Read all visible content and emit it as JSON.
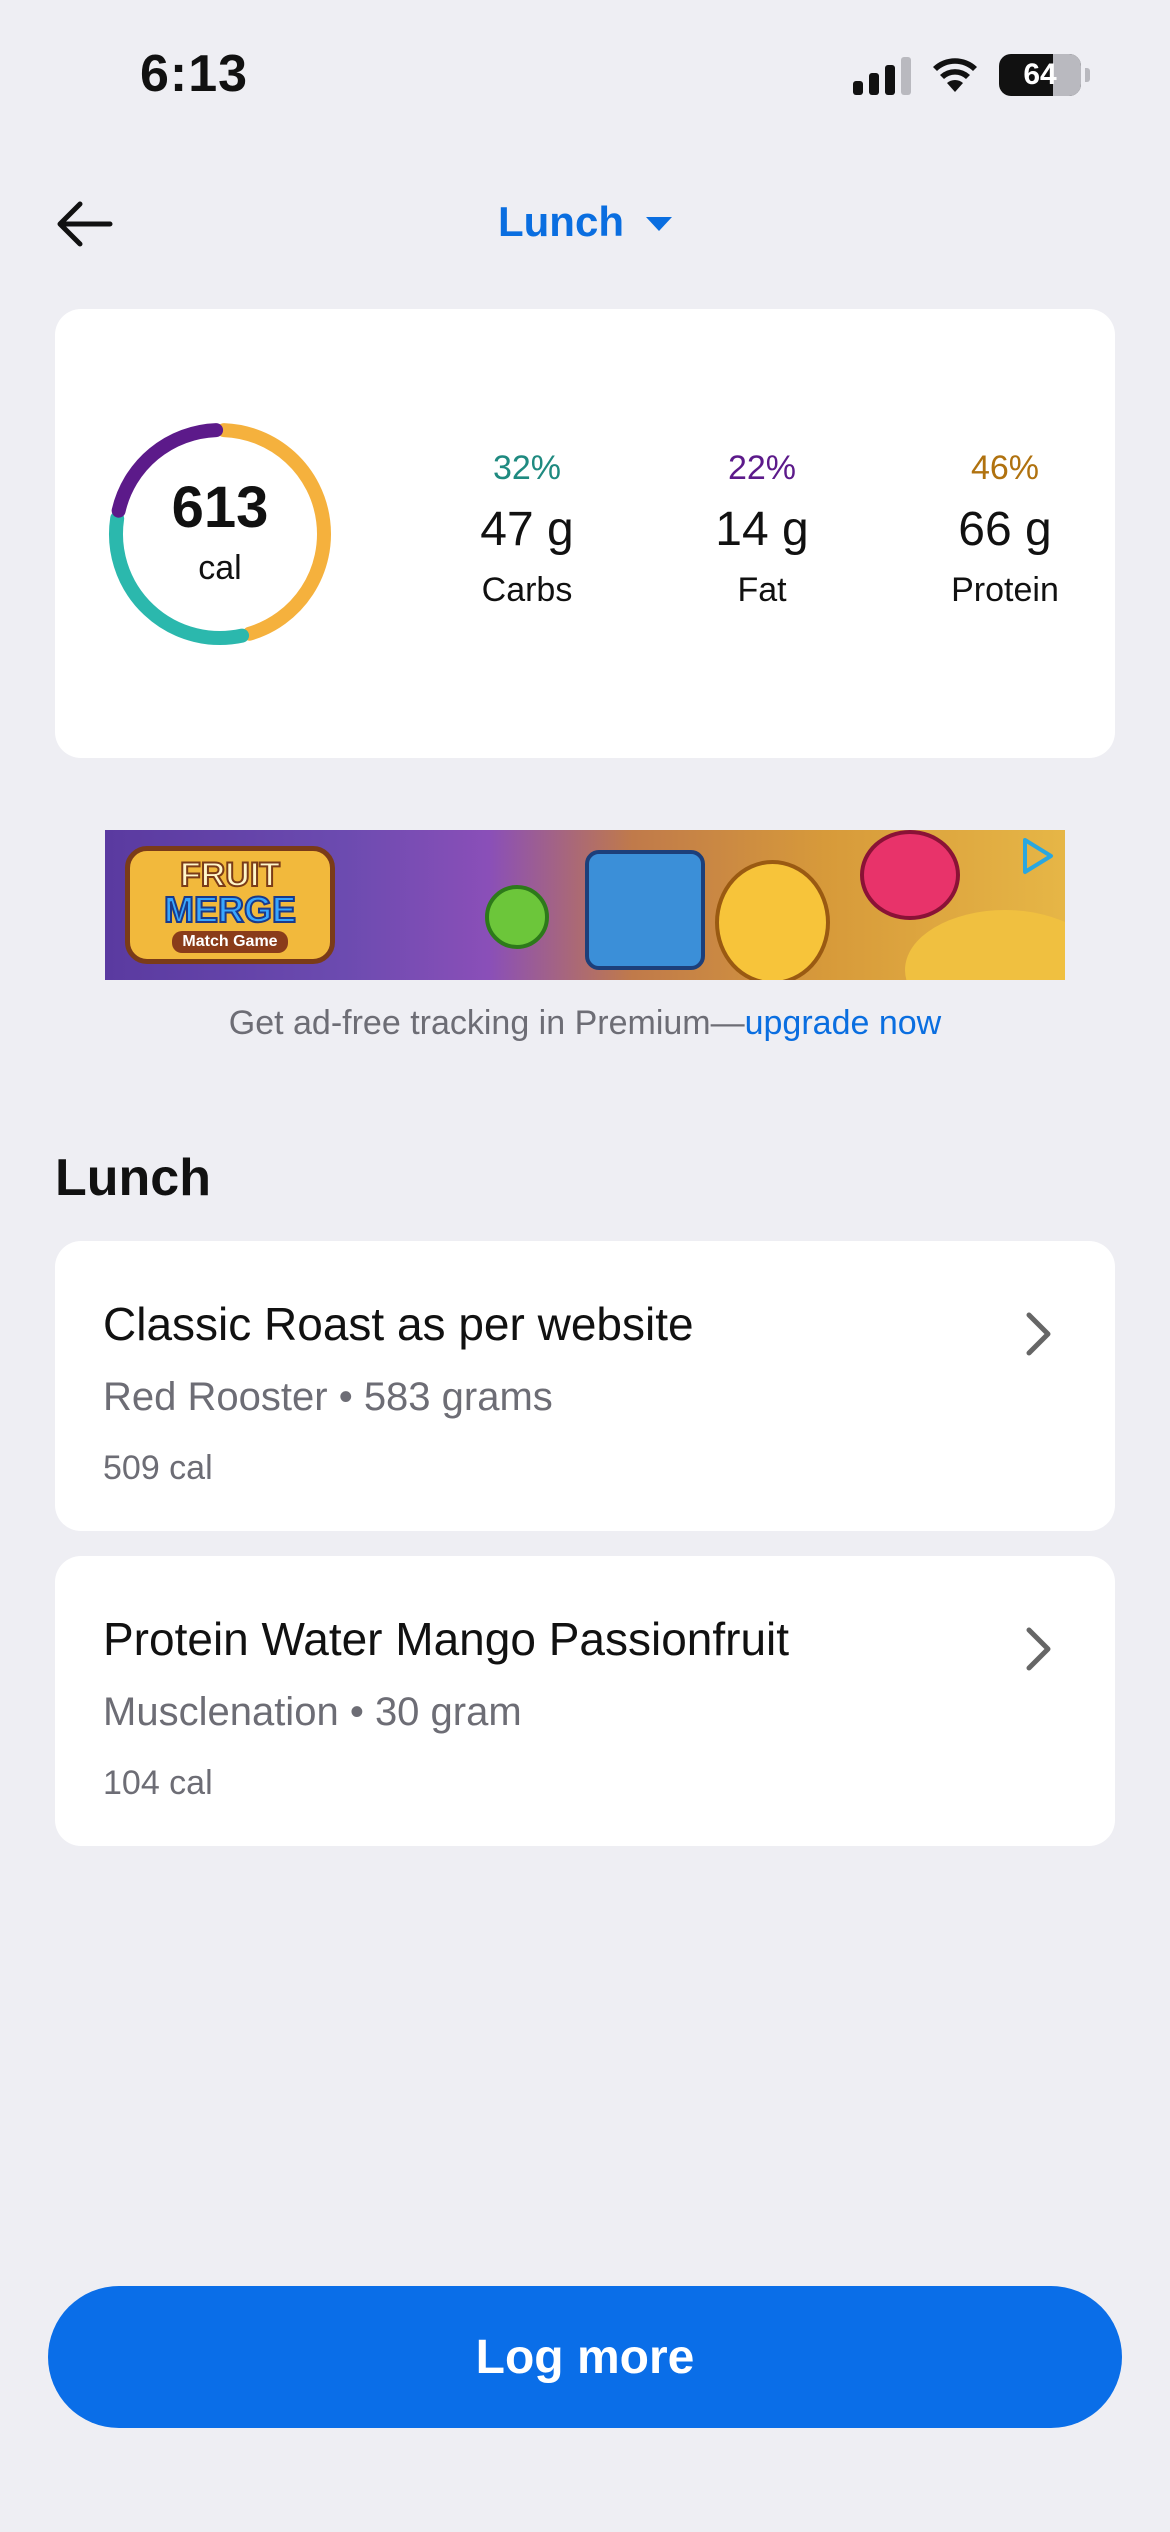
{
  "status_bar": {
    "time": "6:13",
    "battery": "64"
  },
  "header": {
    "title": "Lunch"
  },
  "summary": {
    "calories": "613",
    "calories_unit": "cal",
    "ring_segments": [
      {
        "name": "Protein",
        "fraction": 0.46,
        "color": "#f5b13d"
      },
      {
        "name": "Carbs",
        "fraction": 0.32,
        "color": "#2bb8ad"
      },
      {
        "name": "Fat",
        "fraction": 0.22,
        "color": "#5c1a8a"
      }
    ],
    "macros": [
      {
        "pct": "32%",
        "grams": "47 g",
        "name": "Carbs",
        "color": "#1f8a80"
      },
      {
        "pct": "22%",
        "grams": "14 g",
        "name": "Fat",
        "color": "#5c1a8a"
      },
      {
        "pct": "46%",
        "grams": "66 g",
        "name": "Protein",
        "color": "#b0720f"
      }
    ]
  },
  "ad": {
    "logo_line1": "FRUIT",
    "logo_line2": "MERGE",
    "logo_line3": "Match Game",
    "caption_prefix": "Get ad-free tracking in Premium—",
    "caption_link": "upgrade now"
  },
  "section": {
    "title": "Lunch"
  },
  "foods": [
    {
      "name": "Classic Roast as per website",
      "brand": "Red Rooster",
      "amount": "583 grams",
      "calories": "509 cal"
    },
    {
      "name": "Protein Water Mango Passionfruit",
      "brand": "Musclenation",
      "amount": "30 gram",
      "calories": "104 cal"
    }
  ],
  "actions": {
    "log_more": "Log more"
  },
  "colors": {
    "accent": "#0a6ee0",
    "background": "#eeeef3"
  }
}
